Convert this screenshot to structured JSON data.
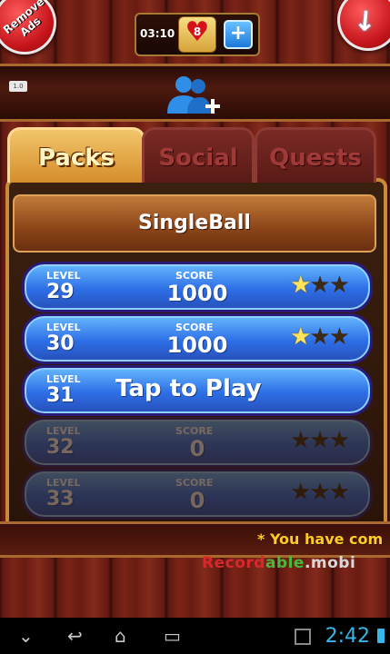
{
  "header": {
    "remove_ads_label": "Remove Ads",
    "timer": "03:10",
    "lives": "8",
    "add_lives_label": "+",
    "back_label": "↙",
    "version_label": "1.0"
  },
  "tabs": [
    {
      "label": "Packs",
      "active": true
    },
    {
      "label": "Social",
      "active": false
    },
    {
      "label": "Quests",
      "active": false
    }
  ],
  "pack": {
    "title": "SingleBall"
  },
  "levels": [
    {
      "level_label": "LEVEL",
      "level": "29",
      "score_label": "SCORE",
      "score": "1000",
      "stars_earned": 1,
      "stars_total": 3,
      "state": "played"
    },
    {
      "level_label": "LEVEL",
      "level": "30",
      "score_label": "SCORE",
      "score": "1000",
      "stars_earned": 1,
      "stars_total": 3,
      "state": "played"
    },
    {
      "level_label": "LEVEL",
      "level": "31",
      "action_text": "Tap to Play",
      "state": "current"
    },
    {
      "level_label": "LEVEL",
      "level": "32",
      "score_label": "SCORE",
      "score": "0",
      "stars_earned": 0,
      "stars_total": 3,
      "state": "locked"
    },
    {
      "level_label": "LEVEL",
      "level": "33",
      "score_label": "SCORE",
      "score": "0",
      "stars_earned": 0,
      "stars_total": 3,
      "state": "locked"
    }
  ],
  "marquee": "* You have com",
  "watermark": {
    "part1": "Record",
    "part2": "able",
    "part3": ".mobi"
  },
  "system": {
    "clock": "2:42"
  },
  "colors": {
    "accent_blue": "#2d6ee6",
    "star_gold": "#ffe35a",
    "tab_active": "#d58d2a",
    "clock": "#35b7e8"
  }
}
